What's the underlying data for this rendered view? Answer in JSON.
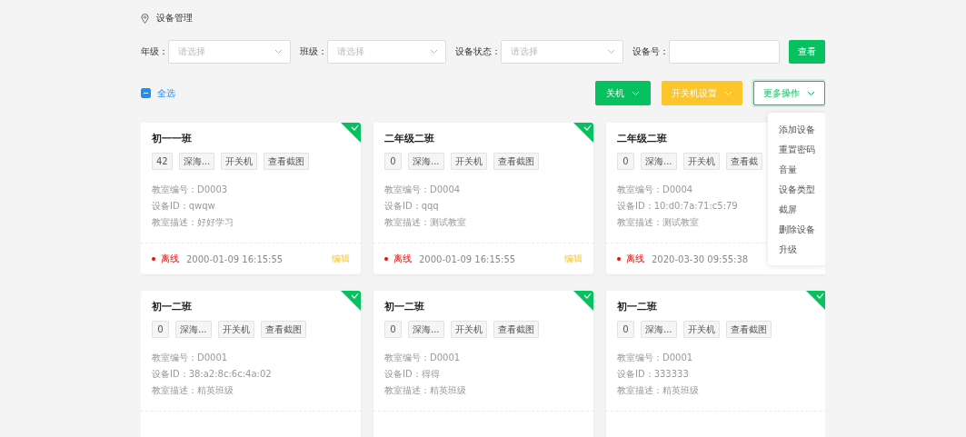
{
  "breadcrumb": "设备管理",
  "filters": [
    {
      "label": "年级：",
      "kind": "select",
      "placeholder": "请选择"
    },
    {
      "label": "班级：",
      "kind": "select",
      "placeholder": "请选择"
    },
    {
      "label": "设备状态：",
      "kind": "select",
      "placeholder": "请选择"
    },
    {
      "label": "设备号：",
      "kind": "input"
    }
  ],
  "search_button": "查看",
  "select_all": {
    "label": "全选",
    "indeterminate": true
  },
  "actions": [
    {
      "label": "关机",
      "kind": "primary",
      "expanded": false
    },
    {
      "label": "开关机设置",
      "kind": "warning",
      "expanded": false
    },
    {
      "label": "更多操作",
      "kind": "outline",
      "expanded": true
    }
  ],
  "more_menu": [
    "添加设备",
    "重置密码",
    "音量",
    "设备类型",
    "截屏",
    "删除设备",
    "升级"
  ],
  "cards": [
    {
      "title": "初一一班",
      "selected": true,
      "tags": [
        "42",
        "深海...",
        "开关机",
        "查看截图"
      ],
      "fields": [
        "教室编号：D0003",
        "设备ID：qwqw",
        "教室描述：好好学习"
      ],
      "status": "离线",
      "time": "2000-01-09 16:15:55",
      "edit": "编辑"
    },
    {
      "title": "二年级二班",
      "selected": true,
      "tags": [
        "0",
        "深海...",
        "开关机",
        "查看截图"
      ],
      "fields": [
        "教室编号：D0004",
        "设备ID：qqq",
        "教室描述：测试教室"
      ],
      "status": "离线",
      "time": "2000-01-09 16:15:55",
      "edit": "编辑"
    },
    {
      "title": "二年级二班",
      "tags": [
        "0",
        "深海...",
        "开关机",
        "查看截"
      ],
      "fields": [
        "教室编号：D0004",
        "设备ID：10:d0:7a:71:c5:79",
        "教室描述：测试教室"
      ],
      "status": "离线",
      "time": "2020-03-30 09:55:38"
    },
    {
      "title": "初一二班",
      "selected": true,
      "tags": [
        "0",
        "深海...",
        "开关机",
        "查看截图"
      ],
      "fields": [
        "教室编号：D0001",
        "设备ID：38:a2:8c:6c:4a:02",
        "教室描述：精英班级"
      ]
    },
    {
      "title": "初一二班",
      "selected": true,
      "tags": [
        "0",
        "深海...",
        "开关机",
        "查看截图"
      ],
      "fields": [
        "教室编号：D0001",
        "设备ID：得得",
        "教室描述：精英班级"
      ]
    },
    {
      "title": "初一二班",
      "selected": true,
      "tags": [
        "0",
        "深海...",
        "开关机",
        "查看截图"
      ],
      "fields": [
        "教室编号：D0001",
        "设备ID：333333",
        "教室描述：精英班级"
      ]
    }
  ]
}
